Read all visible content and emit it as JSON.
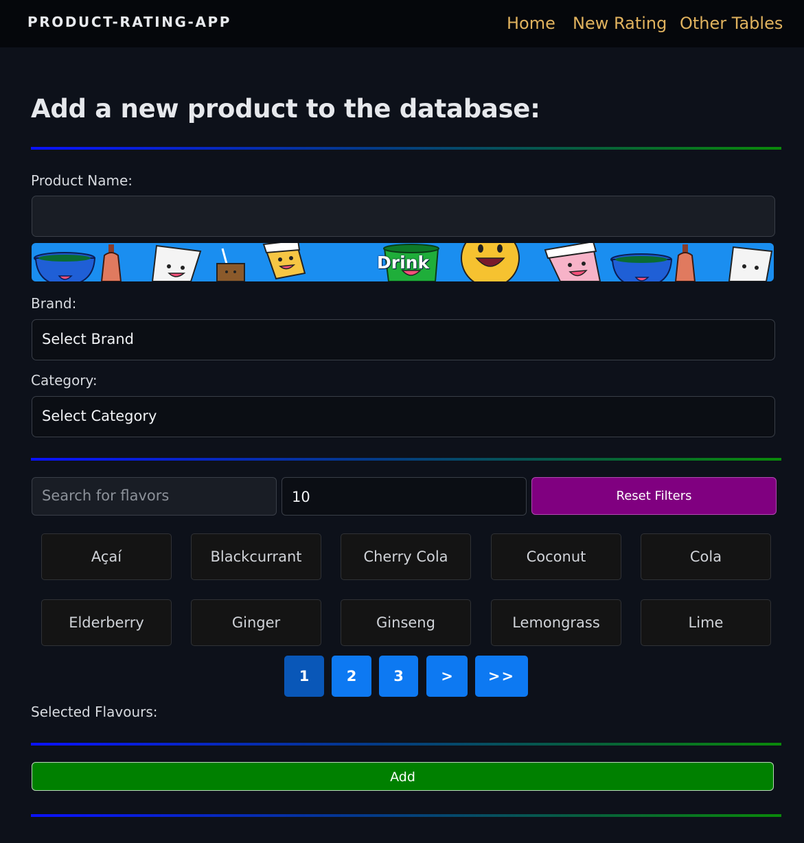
{
  "navbar": {
    "brand": "PRODUCT-RATING-APP",
    "links": [
      "Home",
      "New Rating",
      "Other Tables"
    ]
  },
  "form": {
    "title": "Add a new product to the database:",
    "product_name_label": "Product Name:",
    "product_name_value": "",
    "banner_text": "Drink",
    "brand_label": "Brand:",
    "brand_value": "Select Brand",
    "category_label": "Category:",
    "category_value": "Select Category"
  },
  "flavor_filter": {
    "search_placeholder": "Search for flavors",
    "search_value": "",
    "per_page_value": "10",
    "reset_label": "Reset Filters",
    "flavors": [
      "Açaí",
      "Blackcurrant",
      "Cherry Cola",
      "Coconut",
      "Cola",
      "Elderberry",
      "Ginger",
      "Ginseng",
      "Lemongrass",
      "Lime"
    ],
    "pagination": [
      "1",
      "2",
      "3",
      ">",
      ">>"
    ],
    "current_page": "1"
  },
  "selected_flavours_label": "Selected Flavours:",
  "add_label": "Add",
  "colors": {
    "nav_link": "#e0b25e",
    "reset_button": "#800080",
    "add_button": "#008000",
    "page_button": "#0d79f2",
    "divider_start": "#0a12ff",
    "divider_end": "#0a8a0a"
  }
}
